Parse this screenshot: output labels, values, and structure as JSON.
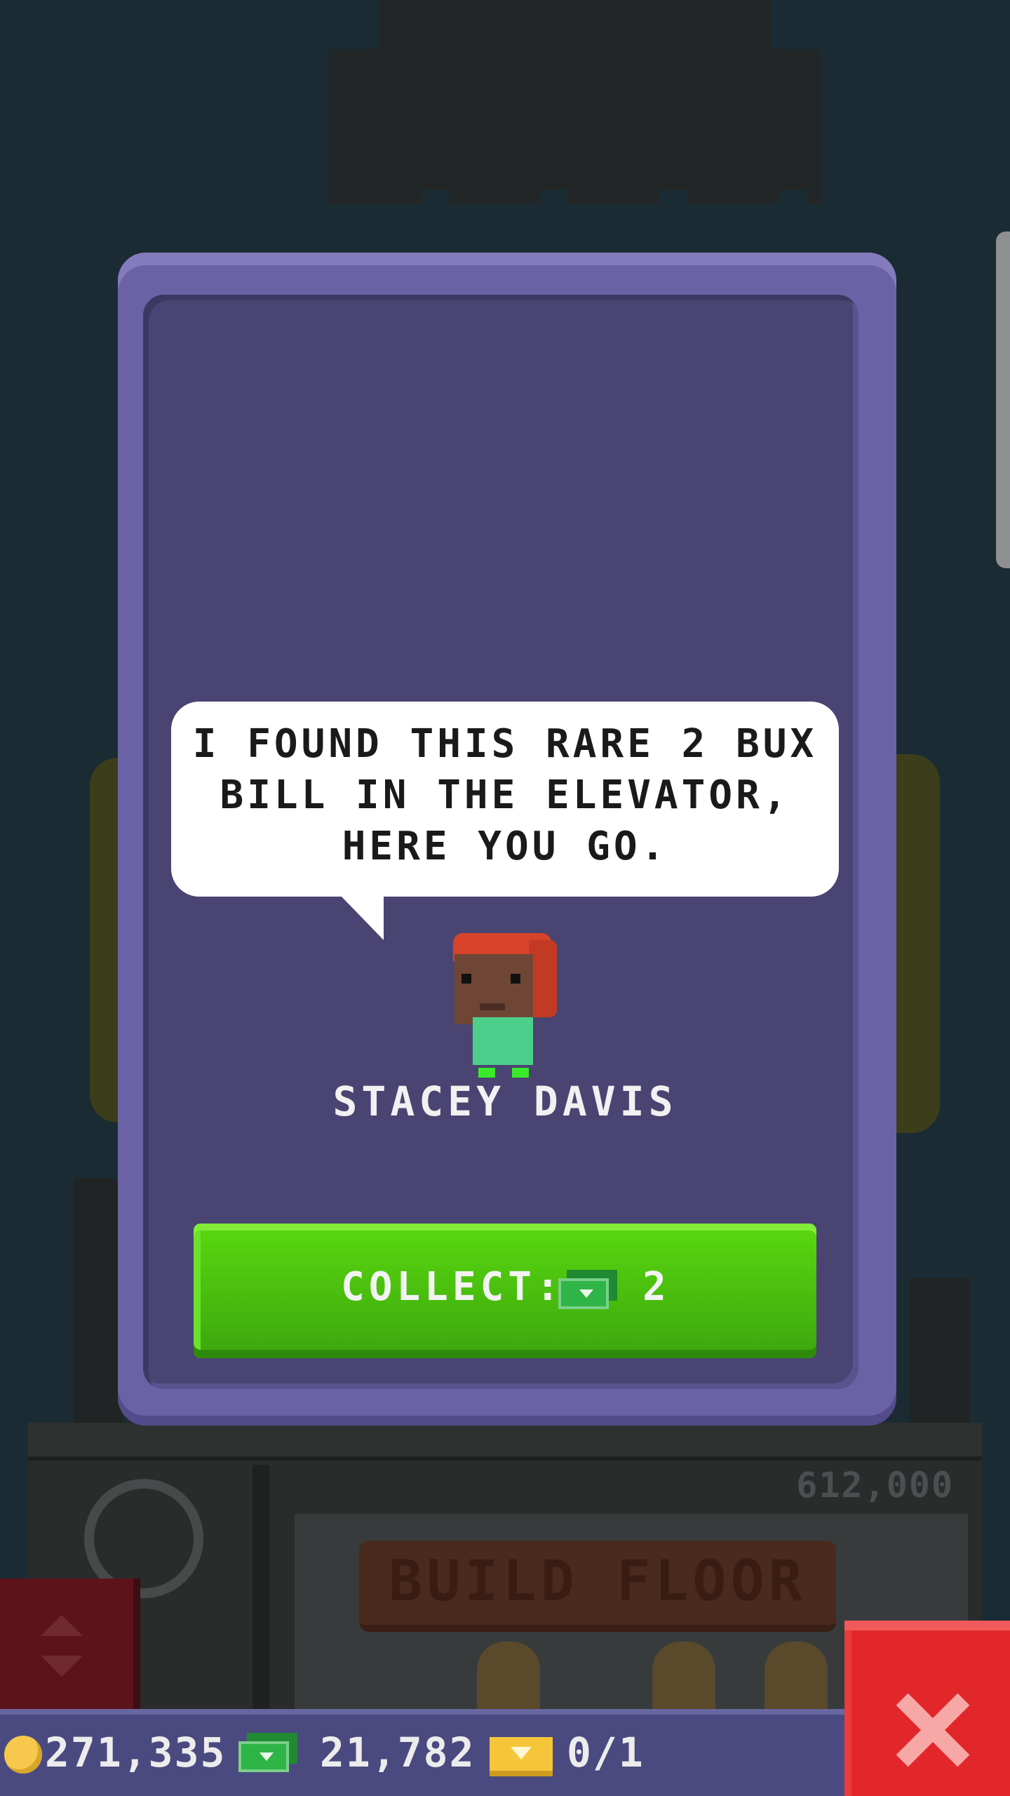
{
  "dialog": {
    "message": "I FOUND THIS RARE 2 BUX BILL IN THE ELEVATOR, HERE YOU GO.",
    "character_name": "STACEY DAVIS",
    "collect_label": "COLLECT:",
    "collect_value": "2",
    "collect_icon": "bux-icon"
  },
  "background": {
    "floor_price": "612,000",
    "build_floor_label": "BUILD FLOOR"
  },
  "status": {
    "coins": "271,335",
    "bux": "21,782",
    "vip": "0/1"
  },
  "colors": {
    "card": "#6b62a6",
    "card_inner": "#4a4472",
    "collect_button": "#4cc30e",
    "close_button": "#e2272b",
    "status_bar": "#4a4a80"
  }
}
